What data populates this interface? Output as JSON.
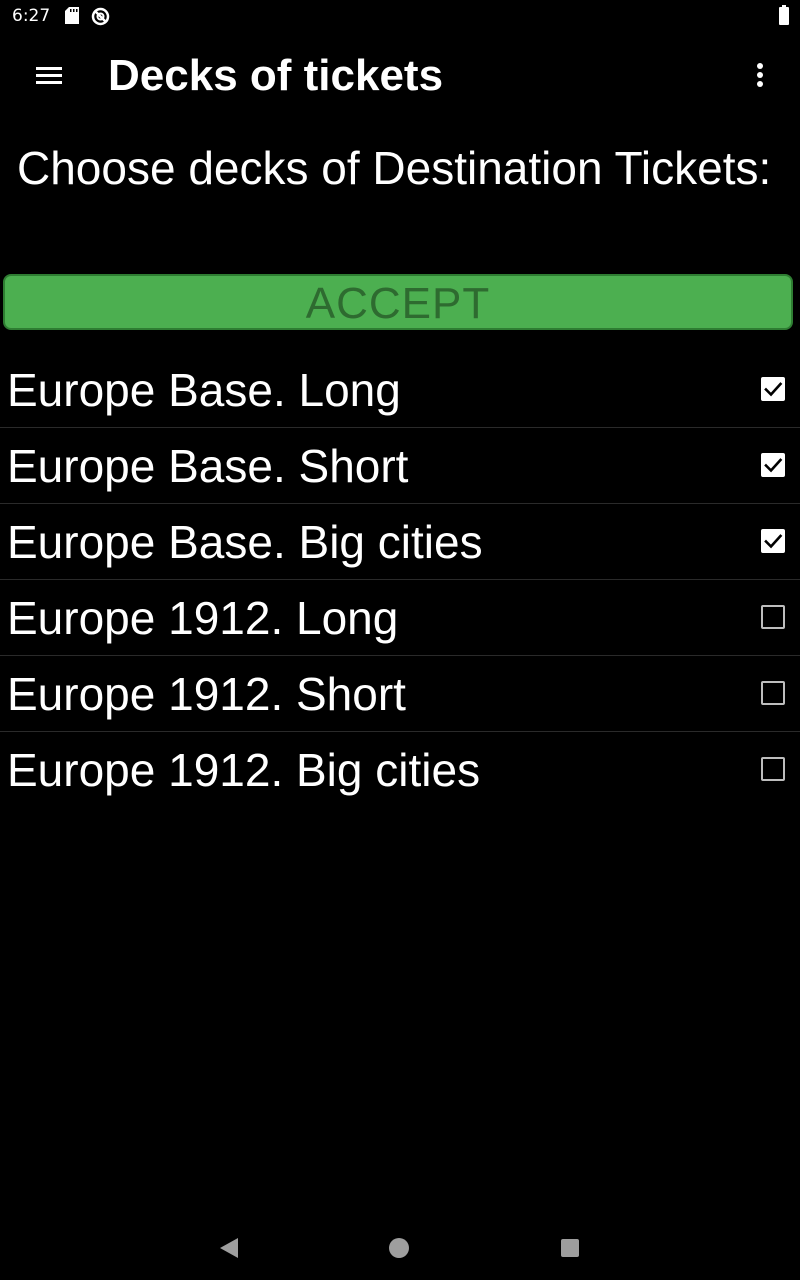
{
  "status_bar": {
    "time": "6:27",
    "icons": [
      "sd-card-icon",
      "sync-disabled-icon",
      "battery-icon"
    ]
  },
  "app_bar": {
    "title": "Decks of tickets",
    "menu_icon": "hamburger-menu-icon",
    "overflow_icon": "more-vert-icon"
  },
  "prompt": {
    "text": "Choose decks of Destination Tickets:"
  },
  "accept_button": {
    "label": "ACCEPT",
    "color": "#4caf50",
    "text_color": "#2e6b30"
  },
  "decks": [
    {
      "label": "Europe Base. Long",
      "checked": true
    },
    {
      "label": "Europe Base. Short",
      "checked": true
    },
    {
      "label": "Europe Base. Big cities",
      "checked": true
    },
    {
      "label": "Europe 1912. Long",
      "checked": false
    },
    {
      "label": "Europe 1912. Short",
      "checked": false
    },
    {
      "label": "Europe 1912. Big cities",
      "checked": false
    }
  ],
  "nav_bar": {
    "icons": [
      "back-icon",
      "home-icon",
      "recents-icon"
    ]
  }
}
